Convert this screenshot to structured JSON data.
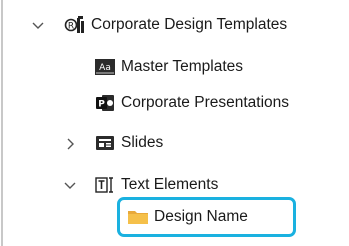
{
  "tree": {
    "root": {
      "label": "Corporate Design Templates",
      "icon": "office-templates-icon",
      "expanded": true
    },
    "items": [
      {
        "label": "Master Templates",
        "icon": "master-template-icon"
      },
      {
        "label": "Corporate Presentations",
        "icon": "powerpoint-icon"
      },
      {
        "label": "Slides",
        "icon": "slides-icon",
        "expanded": false
      },
      {
        "label": "Text Elements",
        "icon": "text-elements-icon",
        "expanded": true
      }
    ],
    "selected": {
      "label": "Design Name",
      "icon": "folder-icon"
    }
  },
  "colors": {
    "selection_border": "#1ab1e0",
    "folder": "#f5c04a"
  }
}
